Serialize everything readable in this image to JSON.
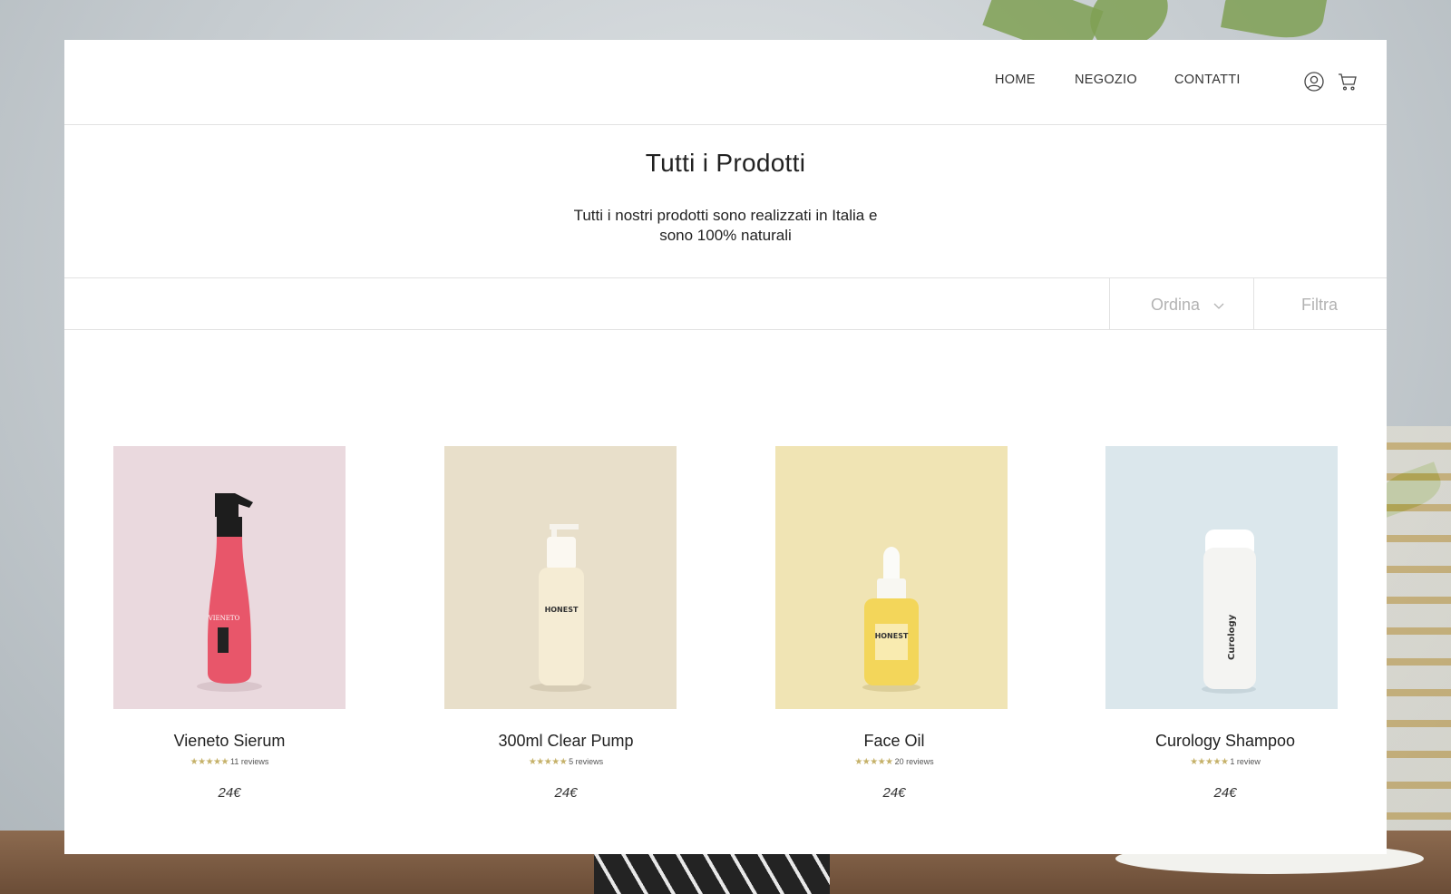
{
  "nav": {
    "items": [
      {
        "label": "HOME"
      },
      {
        "label": "NEGOZIO"
      },
      {
        "label": "CONTATTI"
      }
    ],
    "icons": [
      "user-icon",
      "cart-icon"
    ]
  },
  "hero": {
    "title": "Tutti i Prodotti",
    "subtitle_line1": "Tutti i nostri prodotti sono realizzati in Italia e",
    "subtitle_line2": "sono 100% naturali"
  },
  "toolbar": {
    "sort_label": "Ordina",
    "filter_label": "Filtra"
  },
  "products": [
    {
      "name": "Vieneto Sierum",
      "stars": "★★★★★",
      "reviews": "11 reviews",
      "price": "24€",
      "image_bg": "#ead9de",
      "bottle_label": "VIENETO"
    },
    {
      "name": "300ml Clear Pump",
      "stars": "★★★★★",
      "reviews": "5 reviews",
      "price": "24€",
      "image_bg": "#e8dfca",
      "bottle_label": "HONEST"
    },
    {
      "name": "Face Oil",
      "stars": "★★★★★",
      "reviews": "20 reviews",
      "price": "24€",
      "image_bg": "#f0e4b4",
      "bottle_label": "HONEST"
    },
    {
      "name": "Curology Shampoo",
      "stars": "★★★★★",
      "reviews": "1 review",
      "price": "24€",
      "image_bg": "#dbe7ec",
      "bottle_label": "Curology"
    }
  ],
  "colors": {
    "star": "#c5b169",
    "muted_text": "#b3b3b3",
    "divider": "#e2e2e2"
  }
}
